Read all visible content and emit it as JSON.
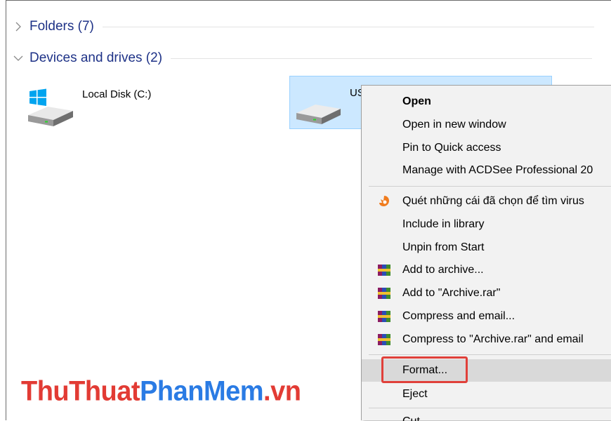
{
  "groups": {
    "folders": {
      "label": "Folders (7)"
    },
    "devices": {
      "label": "Devices and drives (2)"
    }
  },
  "drives": [
    {
      "label": "Local Disk (C:)"
    },
    {
      "label": "US"
    }
  ],
  "context_menu": {
    "items": [
      {
        "label": "Open",
        "bold": true
      },
      {
        "label": "Open in new window"
      },
      {
        "label": "Pin to Quick access"
      },
      {
        "label": "Manage with ACDSee Professional 20"
      },
      {
        "label": "Quét những cái đã chọn để tìm virus",
        "icon": "avast-icon"
      },
      {
        "label": "Include in library"
      },
      {
        "label": "Unpin from Start"
      },
      {
        "label": "Add to archive...",
        "icon": "winrar-icon"
      },
      {
        "label": "Add to \"Archive.rar\"",
        "icon": "winrar-icon"
      },
      {
        "label": "Compress and email...",
        "icon": "winrar-icon"
      },
      {
        "label": "Compress to \"Archive.rar\" and email",
        "icon": "winrar-icon"
      },
      {
        "label": "Format..."
      },
      {
        "label": "Eject"
      },
      {
        "label": "Cut"
      }
    ]
  },
  "watermark": {
    "part1": "ThuThuat",
    "part2": "PhanMem",
    "part3": ".vn"
  },
  "colors": {
    "group_header": "#1e3287",
    "selection_fill": "#cce8ff",
    "highlight_box": "#e0403a"
  }
}
